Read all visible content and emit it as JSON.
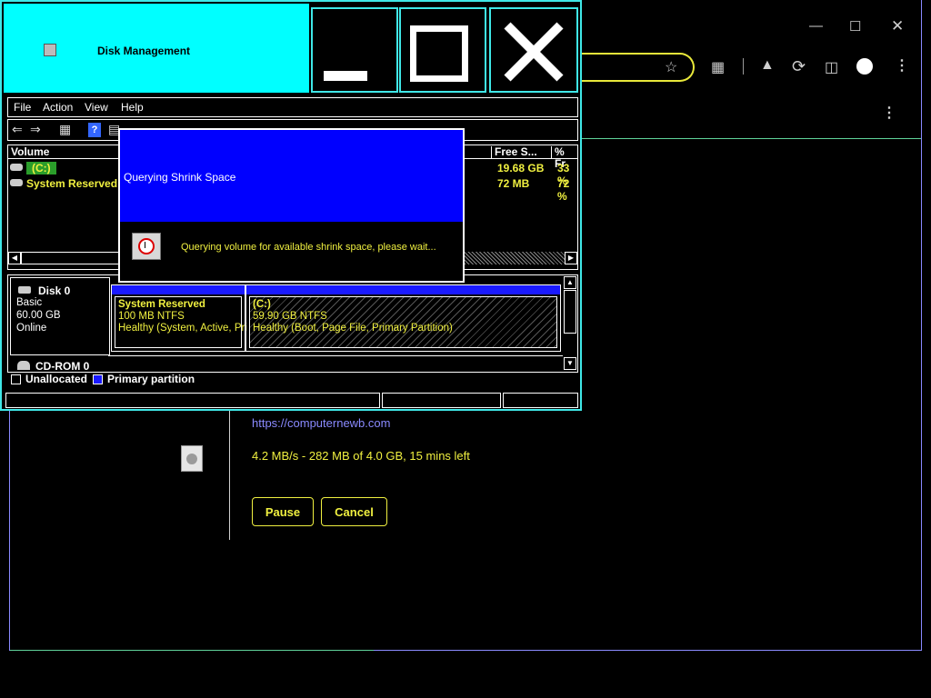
{
  "browser": {
    "download": {
      "url": "https://computernewb.com",
      "status": "4.2 MB/s - 282 MB of 4.0 GB, 15 mins left",
      "pause_label": "Pause",
      "cancel_label": "Cancel"
    },
    "icons": [
      "star-icon",
      "extensions-icon",
      "labs-flask-icon",
      "refresh-icon",
      "side-panel-icon",
      "profile-icon",
      "kebab-menu-icon"
    ],
    "window_controls": [
      "minimize-icon",
      "maximize-icon",
      "close-icon"
    ]
  },
  "disk_mgmt": {
    "title": "Disk Management",
    "menu": [
      "File",
      "Action",
      "View",
      "Help"
    ],
    "volume_table": {
      "headers": [
        "Volume",
        "Free S...",
        "% Fr"
      ],
      "rows": [
        {
          "volume": "(C:)",
          "free": "19.68 GB",
          "pct": "33 %"
        },
        {
          "volume": "System Reserved",
          "free": "72 MB",
          "pct": "72 %"
        }
      ]
    },
    "disk": {
      "name": "Disk 0",
      "type": "Basic",
      "size": "60.00 GB",
      "status": "Online"
    },
    "partitions": [
      {
        "name": "System Reserved",
        "size": "100 MB NTFS",
        "status": "Healthy (System, Active, Pri"
      },
      {
        "name": "(C:)",
        "size": "59.90 GB NTFS",
        "status": "Healthy (Boot, Page File, Primary Partition)"
      }
    ],
    "cdrom": "CD-ROM 0",
    "legend": [
      "Unallocated",
      "Primary partition"
    ],
    "colors": {
      "title_bg": "#00ffff",
      "accent_text": "#f0f040",
      "partition_header": "#1a1aff",
      "window_border": "#3fe8e8"
    }
  },
  "dialog": {
    "title": "Querying Shrink Space",
    "message": "Querying volume for available shrink space, please wait...",
    "colors": {
      "title_bg": "#0000ff"
    }
  }
}
